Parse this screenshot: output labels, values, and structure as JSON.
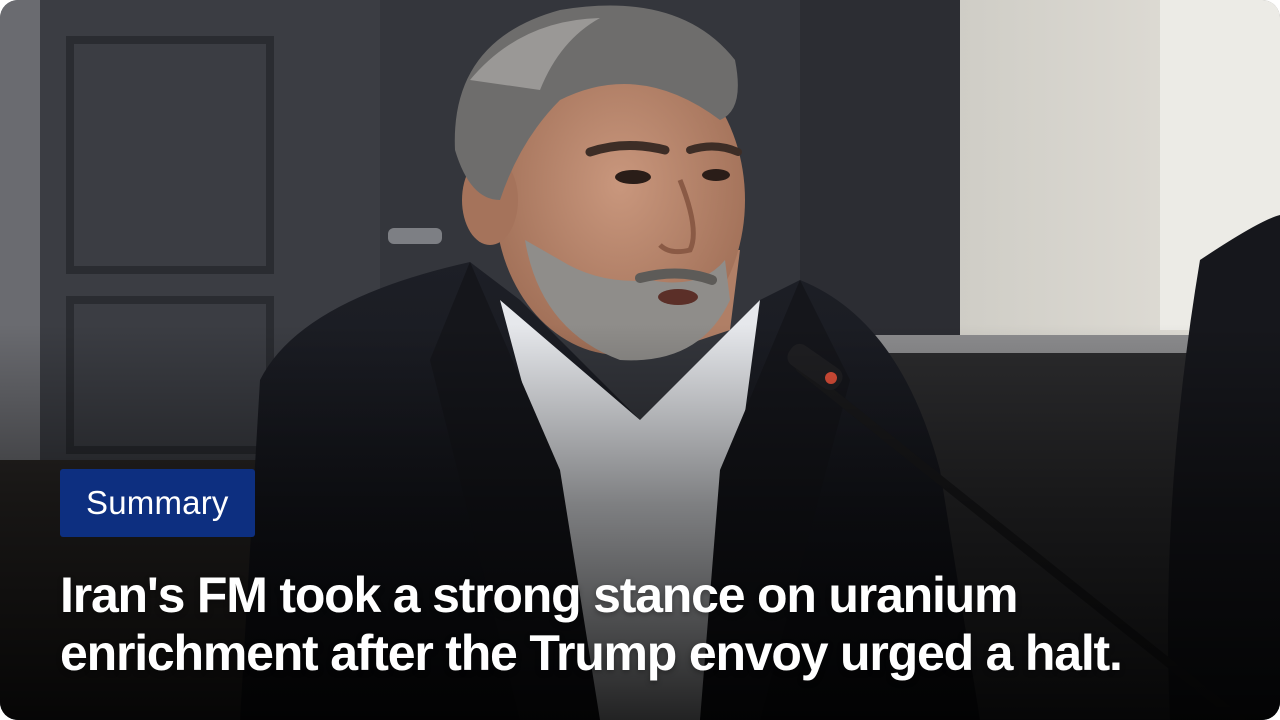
{
  "card": {
    "badge_label": "Summary",
    "headline": "Iran's FM took a strong stance on uranium enrichment after the Trump envoy urged a halt."
  },
  "colors": {
    "badge_background": "#0d2f80",
    "headline_text": "#ffffff"
  }
}
